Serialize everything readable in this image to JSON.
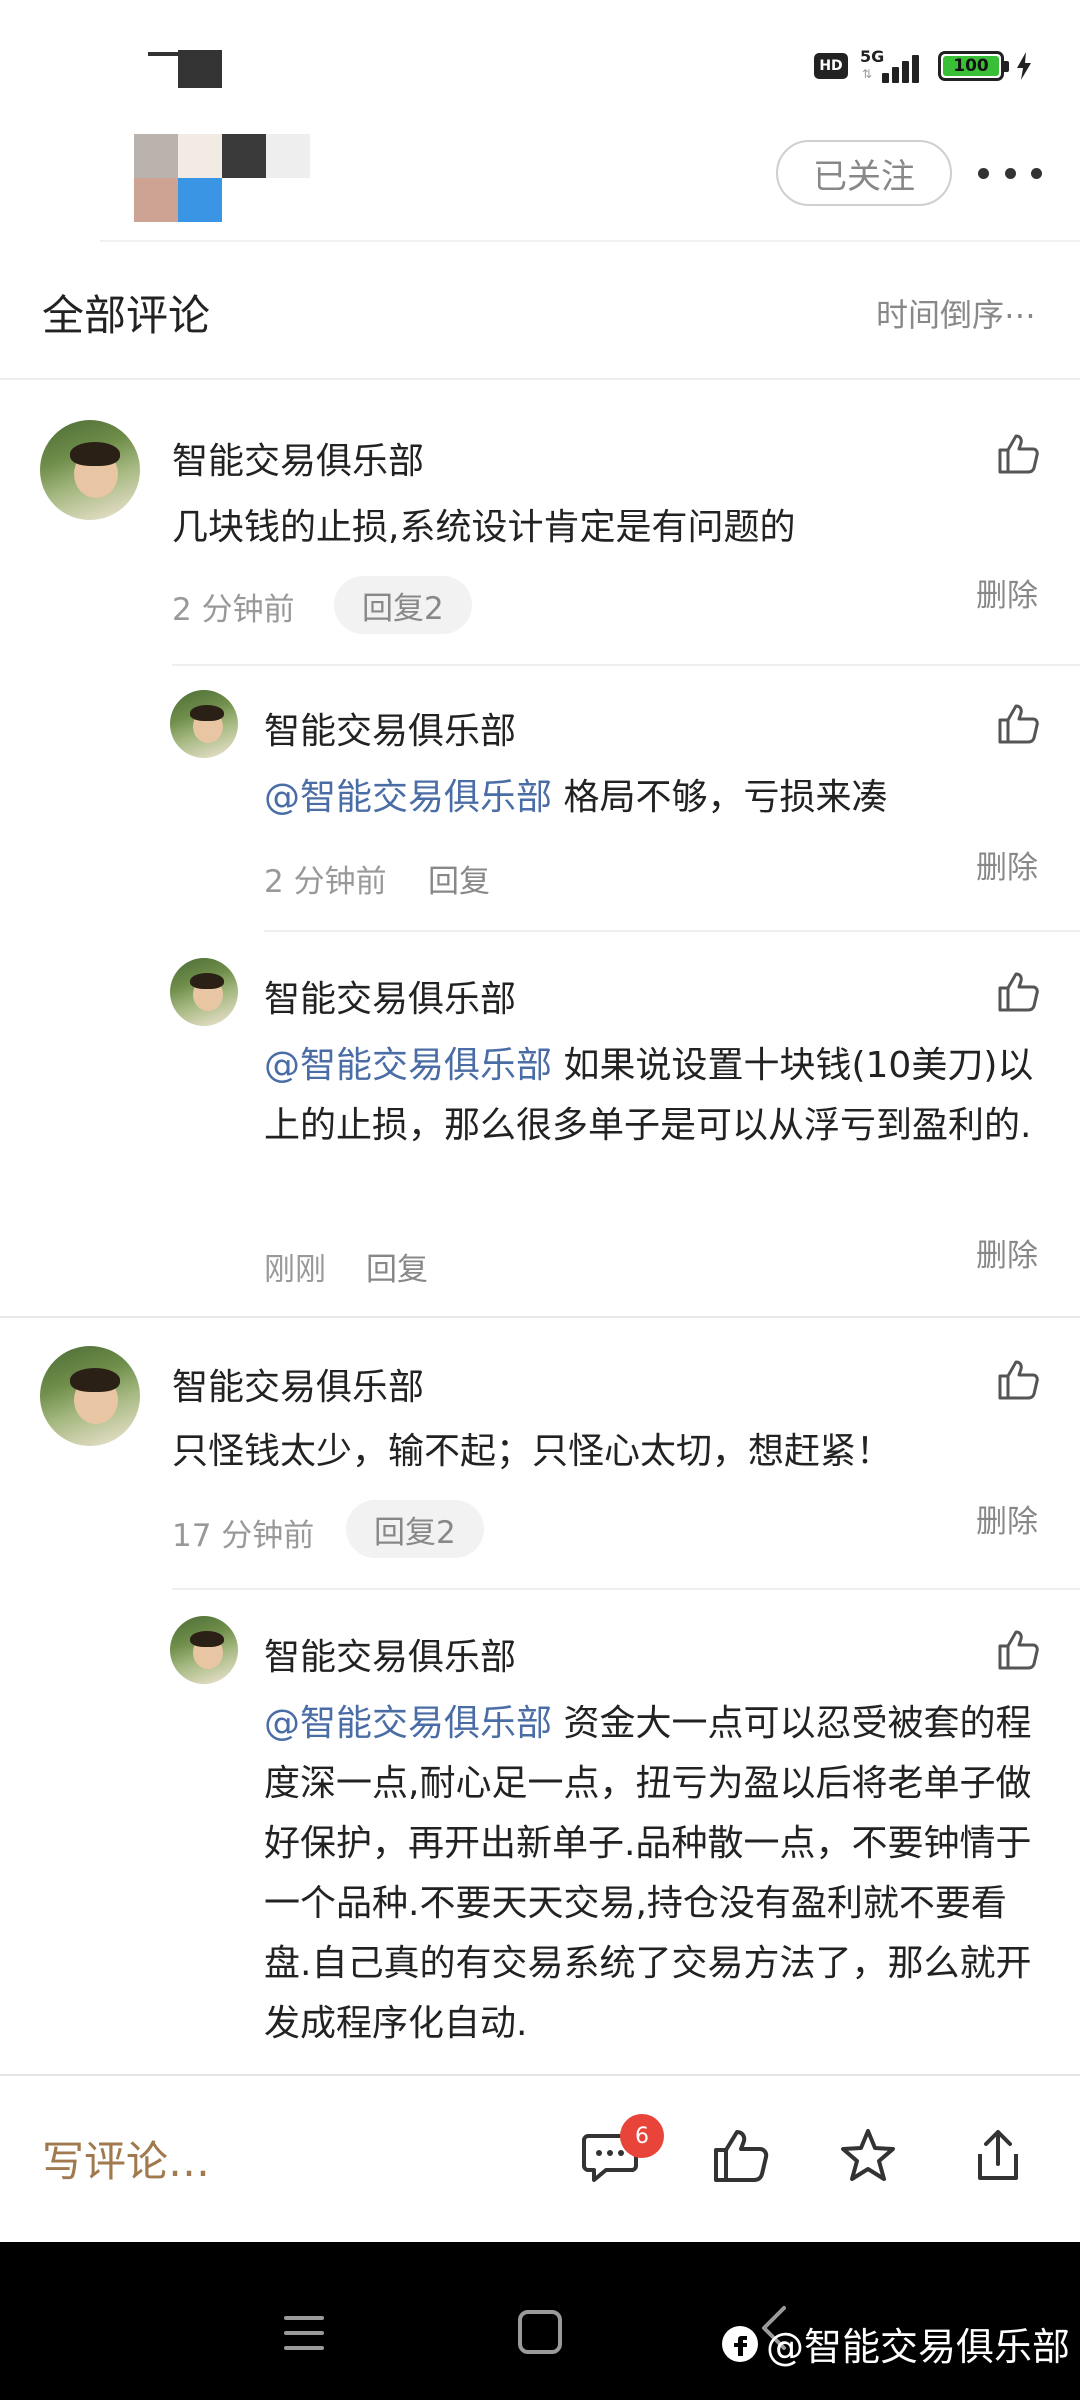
{
  "status_bar": {
    "hd": "HD",
    "network": "5G",
    "battery": "100"
  },
  "header": {
    "follow_label": "已关注"
  },
  "section": {
    "title": "全部评论",
    "sort_label": "时间倒序⋯"
  },
  "comments": [
    {
      "user": "智能交易俱乐部",
      "text": "几块钱的止损,系统设计肯定是有问题的",
      "time": "2 分钟前",
      "reply_label": "回复2",
      "delete_label": "删除",
      "replies": [
        {
          "user": "智能交易俱乐部",
          "mention": "@智能交易俱乐部",
          "text": " 格局不够，亏损来凑",
          "time": "2 分钟前",
          "reply_label": "回复",
          "delete_label": "删除"
        },
        {
          "user": "智能交易俱乐部",
          "mention": "@智能交易俱乐部",
          "text": " 如果说设置十块钱(10美刀)以上的止损，那么很多单子是可以从浮亏到盈利的.",
          "time": "刚刚",
          "reply_label": "回复",
          "delete_label": "删除"
        }
      ]
    },
    {
      "user": "智能交易俱乐部",
      "text": "只怪钱太少，输不起；只怪心太切，想赶紧！",
      "time": "17 分钟前",
      "reply_label": "回复2",
      "delete_label": "删除",
      "replies": [
        {
          "user": "智能交易俱乐部",
          "mention": "@智能交易俱乐部",
          "text": " 资金大一点可以忍受被套的程度深一点,耐心足一点，扭亏为盈以后将老单子做好保护，再开出新单子.品种散一点，不要钟情于一个品种.不要天天交易,持仓没有盈利就不要看盘.自己真的有交易系统了交易方法了，那么就开发成程序化自动."
        }
      ]
    }
  ],
  "bottom_bar": {
    "write_placeholder": "写评论…",
    "comment_count": "6",
    "icons": [
      "comment-icon",
      "like-icon",
      "star-icon",
      "share-icon"
    ]
  },
  "watermark": {
    "text": "@智能交易俱乐部"
  },
  "colors": {
    "mention": "#4a6da6",
    "write_comment": "#a07a4e",
    "badge": "#e8443a"
  }
}
